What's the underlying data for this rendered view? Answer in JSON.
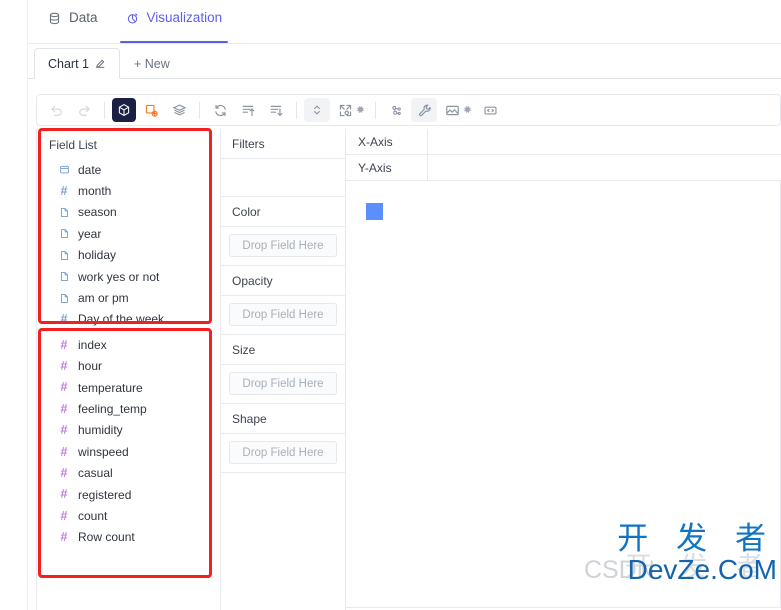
{
  "top_tabs": [
    {
      "label": "Data",
      "icon": "database-icon",
      "active": false
    },
    {
      "label": "Visualization",
      "icon": "chart-pie-icon",
      "active": true
    }
  ],
  "chart_tabs": {
    "current": "Chart 1",
    "edit_icon": "pencil-edit-icon",
    "new_label": "+ New"
  },
  "toolbar": {
    "buttons": [
      {
        "name": "undo-icon",
        "title": "Undo"
      },
      {
        "name": "redo-icon",
        "title": "Redo"
      },
      {
        "name": "cube-icon",
        "title": "Mark Type"
      },
      {
        "name": "shape-add-icon",
        "title": "Add Shape"
      },
      {
        "name": "layers-stack-icon",
        "title": "Layers"
      },
      {
        "name": "refresh-icon",
        "title": "Refresh"
      },
      {
        "name": "sort-ascending-icon",
        "title": "Sort Ascending"
      },
      {
        "name": "sort-descending-icon",
        "title": "Sort Descending"
      },
      {
        "name": "expand-vertical-icon",
        "title": "Size Mode"
      },
      {
        "name": "fit-screen-icon",
        "title": "Fit"
      },
      {
        "name": "fit-screen-gear-icon",
        "title": "Fit Settings"
      },
      {
        "name": "dots-connect-icon",
        "title": "Interaction"
      },
      {
        "name": "wrench-icon",
        "title": "Tools"
      },
      {
        "name": "image-icon",
        "title": "Background Image"
      },
      {
        "name": "image-gear-icon",
        "title": "Image Settings"
      },
      {
        "name": "code-icon",
        "title": "Code"
      }
    ]
  },
  "field_list": {
    "title": "Field List",
    "group_dimensions": [
      {
        "label": "date",
        "icon": "calendar-icon",
        "kind": "date"
      },
      {
        "label": "month",
        "icon": "hash-icon",
        "kind": "measure-blue"
      },
      {
        "label": "season",
        "icon": "document-icon",
        "kind": "dimension"
      },
      {
        "label": "year",
        "icon": "document-icon",
        "kind": "dimension"
      },
      {
        "label": "holiday",
        "icon": "document-icon",
        "kind": "dimension"
      },
      {
        "label": "work yes or not",
        "icon": "document-icon",
        "kind": "dimension"
      },
      {
        "label": "am or pm",
        "icon": "document-icon",
        "kind": "dimension"
      },
      {
        "label": "Day of the week",
        "icon": "hash-icon",
        "kind": "measure-blue"
      }
    ],
    "group_measures": [
      {
        "label": "index",
        "icon": "hash-icon",
        "kind": "measure"
      },
      {
        "label": "hour",
        "icon": "hash-icon",
        "kind": "measure"
      },
      {
        "label": "temperature",
        "icon": "hash-icon",
        "kind": "measure"
      },
      {
        "label": "feeling_temp",
        "icon": "hash-icon",
        "kind": "measure"
      },
      {
        "label": "humidity",
        "icon": "hash-icon",
        "kind": "measure"
      },
      {
        "label": "winspeed",
        "icon": "hash-icon",
        "kind": "measure"
      },
      {
        "label": "casual",
        "icon": "hash-icon",
        "kind": "measure"
      },
      {
        "label": "registered",
        "icon": "hash-icon",
        "kind": "measure"
      },
      {
        "label": "count",
        "icon": "hash-icon",
        "kind": "measure"
      },
      {
        "label": "Row count",
        "icon": "hash-icon",
        "kind": "measure"
      }
    ]
  },
  "shelves": [
    {
      "title": "Filters",
      "placeholder": "",
      "has_drop": false
    },
    {
      "title": "Color",
      "placeholder": "Drop Field Here",
      "has_drop": true
    },
    {
      "title": "Opacity",
      "placeholder": "Drop Field Here",
      "has_drop": true
    },
    {
      "title": "Size",
      "placeholder": "Drop Field Here",
      "has_drop": true
    },
    {
      "title": "Shape",
      "placeholder": "Drop Field Here",
      "has_drop": true
    }
  ],
  "axes": [
    {
      "label": "X-Axis",
      "value": ""
    },
    {
      "label": "Y-Axis",
      "value": ""
    }
  ],
  "plot": {
    "mark_color": "#5b8ff9"
  },
  "watermark": {
    "cn": "开 发 者",
    "en": "DevZe.CoM",
    "ghost": "CSDN"
  },
  "colors": {
    "accent": "#5b5ff0",
    "annotation": "#f42020",
    "mark": "#5b8ff9",
    "hash_blue": "#7d9ccc",
    "hash_purple": "#c07ddb",
    "toolbar_active": "#1b1f45",
    "toolbar_orange": "#f4792b"
  }
}
